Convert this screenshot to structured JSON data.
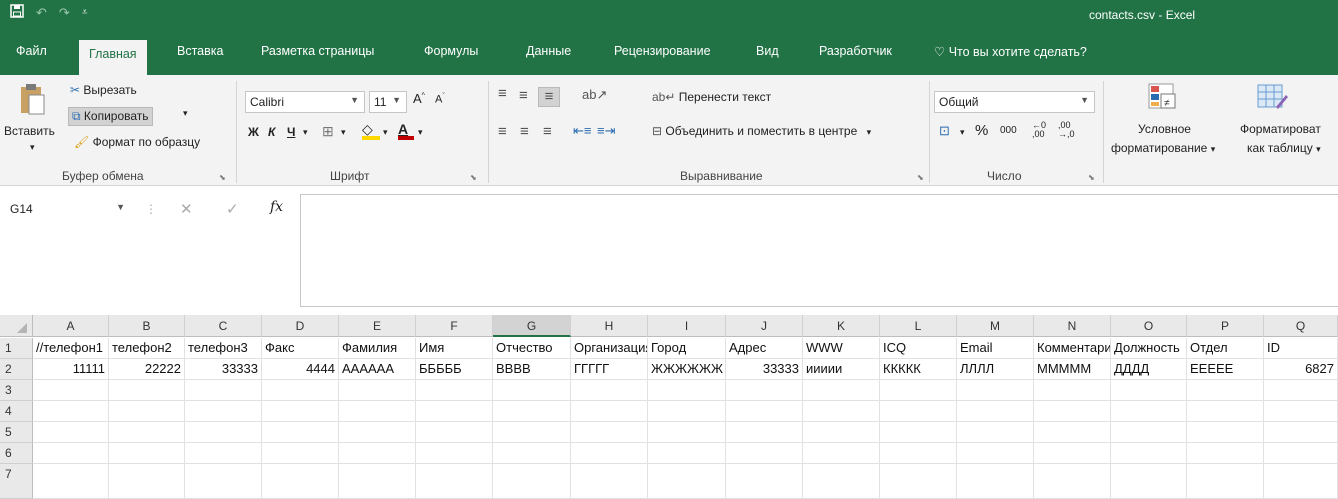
{
  "window": {
    "title": "contacts.csv  -  Excel"
  },
  "qat": {
    "save_icon": "save-icon",
    "undo_glyph": "↶",
    "redo_glyph": "↷",
    "customize_glyph": "⩡"
  },
  "tabs": [
    "Файл",
    "Главная",
    "Вставка",
    "Разметка страницы",
    "Формулы",
    "Данные",
    "Рецензирование",
    "Вид",
    "Разработчик"
  ],
  "tell_me": "Что вы хотите сделать?",
  "ribbon": {
    "clipboard": {
      "paste": "Вставить",
      "cut": "Вырезать",
      "copy": "Копировать",
      "format_painter": "Формат по образцу",
      "label": "Буфер обмена"
    },
    "font": {
      "name": "Calibri",
      "size": "11",
      "bold": "Ж",
      "italic": "К",
      "underline": "Ч",
      "label": "Шрифт",
      "font_color": "#c00000",
      "fill_color": "#ffd800"
    },
    "alignment": {
      "wrap": "Перенести текст",
      "merge": "Объединить и поместить в центре",
      "label": "Выравнивание"
    },
    "number": {
      "format": "Общий",
      "percent": "%",
      "thousands": "000",
      "inc_dec": ",00 →,0",
      "dec_dec": ",0 →,00",
      "label": "Число"
    },
    "styles": {
      "conditional_1": "Условное",
      "conditional_2": "форматирование",
      "table_1": "Форматироват",
      "table_2": "как таблицу"
    }
  },
  "formula_bar": {
    "name_box": "G14",
    "fx": "fx",
    "content": ""
  },
  "sheet": {
    "columns": [
      "A",
      "B",
      "C",
      "D",
      "E",
      "F",
      "G",
      "H",
      "I",
      "J",
      "K",
      "L",
      "M",
      "N",
      "O",
      "P",
      "Q"
    ],
    "selected_column": "G",
    "row_numbers": [
      "1",
      "2",
      "3",
      "4",
      "5",
      "6",
      "7"
    ],
    "header_row": [
      "//телефон1",
      "телефон2",
      "телефон3",
      "Факс",
      "Фамилия",
      "Имя",
      "Отчество",
      "Организация",
      "Город",
      "Адрес",
      "WWW",
      "ICQ",
      "Email",
      "Комментарий",
      "Должность",
      "Отдел",
      "ID"
    ],
    "data_row": [
      "11111",
      "22222",
      "33333",
      "4444",
      "АААААА",
      "БББББ",
      "ВВВВ",
      "ГГГГГ",
      "ЖЖЖЖЖЖ",
      "33333",
      "иииии",
      "ККККК",
      "ЛЛЛЛ",
      "МММММ",
      "ДДДД",
      "ЕЕЕЕЕ",
      "6827"
    ]
  }
}
